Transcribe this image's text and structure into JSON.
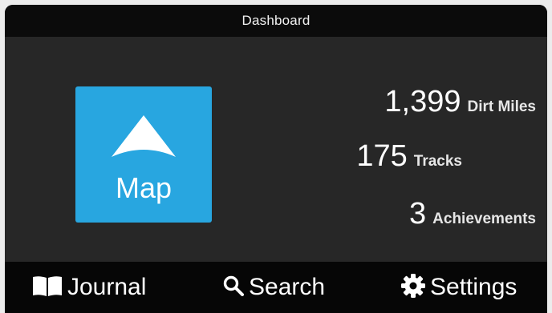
{
  "header": {
    "title": "Dashboard"
  },
  "map_tile": {
    "label": "Map",
    "color": "#28a6e0",
    "icon": "navigation-arrow-icon"
  },
  "stats": [
    {
      "value": "1,399",
      "label": "Dirt Miles"
    },
    {
      "value": "175",
      "label": "Tracks"
    },
    {
      "value": "3",
      "label": "Achievements"
    }
  ],
  "bottom_nav": {
    "journal": {
      "label": "Journal",
      "icon": "book-icon"
    },
    "search": {
      "label": "Search",
      "icon": "search-icon"
    },
    "settings": {
      "label": "Settings",
      "icon": "gear-icon"
    }
  }
}
